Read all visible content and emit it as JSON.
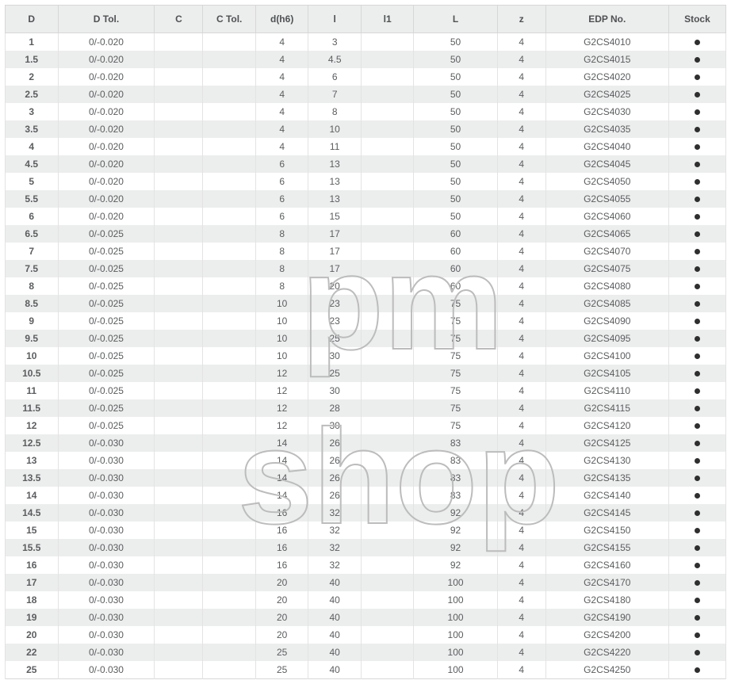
{
  "watermark": {
    "top": "pm",
    "bottom": "shop"
  },
  "columns": [
    {
      "key": "D",
      "label": "D"
    },
    {
      "key": "Dtol",
      "label": "D Tol."
    },
    {
      "key": "C",
      "label": "C"
    },
    {
      "key": "Ctol",
      "label": "C Tol."
    },
    {
      "key": "dh6",
      "label": "d(h6)"
    },
    {
      "key": "l",
      "label": "l"
    },
    {
      "key": "l1",
      "label": "l1"
    },
    {
      "key": "L",
      "label": "L"
    },
    {
      "key": "z",
      "label": "z"
    },
    {
      "key": "edp",
      "label": "EDP No."
    },
    {
      "key": "stock",
      "label": "Stock"
    }
  ],
  "rows": [
    {
      "D": "1",
      "Dtol": "0/-0.020",
      "C": "",
      "Ctol": "",
      "dh6": "4",
      "l": "3",
      "l1": "",
      "L": "50",
      "z": "4",
      "edp": "G2CS4010",
      "stock": "●"
    },
    {
      "D": "1.5",
      "Dtol": "0/-0.020",
      "C": "",
      "Ctol": "",
      "dh6": "4",
      "l": "4.5",
      "l1": "",
      "L": "50",
      "z": "4",
      "edp": "G2CS4015",
      "stock": "●"
    },
    {
      "D": "2",
      "Dtol": "0/-0.020",
      "C": "",
      "Ctol": "",
      "dh6": "4",
      "l": "6",
      "l1": "",
      "L": "50",
      "z": "4",
      "edp": "G2CS4020",
      "stock": "●"
    },
    {
      "D": "2.5",
      "Dtol": "0/-0.020",
      "C": "",
      "Ctol": "",
      "dh6": "4",
      "l": "7",
      "l1": "",
      "L": "50",
      "z": "4",
      "edp": "G2CS4025",
      "stock": "●"
    },
    {
      "D": "3",
      "Dtol": "0/-0.020",
      "C": "",
      "Ctol": "",
      "dh6": "4",
      "l": "8",
      "l1": "",
      "L": "50",
      "z": "4",
      "edp": "G2CS4030",
      "stock": "●"
    },
    {
      "D": "3.5",
      "Dtol": "0/-0.020",
      "C": "",
      "Ctol": "",
      "dh6": "4",
      "l": "10",
      "l1": "",
      "L": "50",
      "z": "4",
      "edp": "G2CS4035",
      "stock": "●"
    },
    {
      "D": "4",
      "Dtol": "0/-0.020",
      "C": "",
      "Ctol": "",
      "dh6": "4",
      "l": "11",
      "l1": "",
      "L": "50",
      "z": "4",
      "edp": "G2CS4040",
      "stock": "●"
    },
    {
      "D": "4.5",
      "Dtol": "0/-0.020",
      "C": "",
      "Ctol": "",
      "dh6": "6",
      "l": "13",
      "l1": "",
      "L": "50",
      "z": "4",
      "edp": "G2CS4045",
      "stock": "●"
    },
    {
      "D": "5",
      "Dtol": "0/-0.020",
      "C": "",
      "Ctol": "",
      "dh6": "6",
      "l": "13",
      "l1": "",
      "L": "50",
      "z": "4",
      "edp": "G2CS4050",
      "stock": "●"
    },
    {
      "D": "5.5",
      "Dtol": "0/-0.020",
      "C": "",
      "Ctol": "",
      "dh6": "6",
      "l": "13",
      "l1": "",
      "L": "50",
      "z": "4",
      "edp": "G2CS4055",
      "stock": "●"
    },
    {
      "D": "6",
      "Dtol": "0/-0.020",
      "C": "",
      "Ctol": "",
      "dh6": "6",
      "l": "15",
      "l1": "",
      "L": "50",
      "z": "4",
      "edp": "G2CS4060",
      "stock": "●"
    },
    {
      "D": "6.5",
      "Dtol": "0/-0.025",
      "C": "",
      "Ctol": "",
      "dh6": "8",
      "l": "17",
      "l1": "",
      "L": "60",
      "z": "4",
      "edp": "G2CS4065",
      "stock": "●"
    },
    {
      "D": "7",
      "Dtol": "0/-0.025",
      "C": "",
      "Ctol": "",
      "dh6": "8",
      "l": "17",
      "l1": "",
      "L": "60",
      "z": "4",
      "edp": "G2CS4070",
      "stock": "●"
    },
    {
      "D": "7.5",
      "Dtol": "0/-0.025",
      "C": "",
      "Ctol": "",
      "dh6": "8",
      "l": "17",
      "l1": "",
      "L": "60",
      "z": "4",
      "edp": "G2CS4075",
      "stock": "●"
    },
    {
      "D": "8",
      "Dtol": "0/-0.025",
      "C": "",
      "Ctol": "",
      "dh6": "8",
      "l": "20",
      "l1": "",
      "L": "60",
      "z": "4",
      "edp": "G2CS4080",
      "stock": "●"
    },
    {
      "D": "8.5",
      "Dtol": "0/-0.025",
      "C": "",
      "Ctol": "",
      "dh6": "10",
      "l": "23",
      "l1": "",
      "L": "75",
      "z": "4",
      "edp": "G2CS4085",
      "stock": "●"
    },
    {
      "D": "9",
      "Dtol": "0/-0.025",
      "C": "",
      "Ctol": "",
      "dh6": "10",
      "l": "23",
      "l1": "",
      "L": "75",
      "z": "4",
      "edp": "G2CS4090",
      "stock": "●"
    },
    {
      "D": "9.5",
      "Dtol": "0/-0.025",
      "C": "",
      "Ctol": "",
      "dh6": "10",
      "l": "25",
      "l1": "",
      "L": "75",
      "z": "4",
      "edp": "G2CS4095",
      "stock": "●"
    },
    {
      "D": "10",
      "Dtol": "0/-0.025",
      "C": "",
      "Ctol": "",
      "dh6": "10",
      "l": "30",
      "l1": "",
      "L": "75",
      "z": "4",
      "edp": "G2CS4100",
      "stock": "●"
    },
    {
      "D": "10.5",
      "Dtol": "0/-0.025",
      "C": "",
      "Ctol": "",
      "dh6": "12",
      "l": "25",
      "l1": "",
      "L": "75",
      "z": "4",
      "edp": "G2CS4105",
      "stock": "●"
    },
    {
      "D": "11",
      "Dtol": "0/-0.025",
      "C": "",
      "Ctol": "",
      "dh6": "12",
      "l": "30",
      "l1": "",
      "L": "75",
      "z": "4",
      "edp": "G2CS4110",
      "stock": "●"
    },
    {
      "D": "11.5",
      "Dtol": "0/-0.025",
      "C": "",
      "Ctol": "",
      "dh6": "12",
      "l": "28",
      "l1": "",
      "L": "75",
      "z": "4",
      "edp": "G2CS4115",
      "stock": "●"
    },
    {
      "D": "12",
      "Dtol": "0/-0.025",
      "C": "",
      "Ctol": "",
      "dh6": "12",
      "l": "30",
      "l1": "",
      "L": "75",
      "z": "4",
      "edp": "G2CS4120",
      "stock": "●"
    },
    {
      "D": "12.5",
      "Dtol": "0/-0.030",
      "C": "",
      "Ctol": "",
      "dh6": "14",
      "l": "26",
      "l1": "",
      "L": "83",
      "z": "4",
      "edp": "G2CS4125",
      "stock": "●"
    },
    {
      "D": "13",
      "Dtol": "0/-0.030",
      "C": "",
      "Ctol": "",
      "dh6": "14",
      "l": "26",
      "l1": "",
      "L": "83",
      "z": "4",
      "edp": "G2CS4130",
      "stock": "●"
    },
    {
      "D": "13.5",
      "Dtol": "0/-0.030",
      "C": "",
      "Ctol": "",
      "dh6": "14",
      "l": "26",
      "l1": "",
      "L": "83",
      "z": "4",
      "edp": "G2CS4135",
      "stock": "●"
    },
    {
      "D": "14",
      "Dtol": "0/-0.030",
      "C": "",
      "Ctol": "",
      "dh6": "14",
      "l": "26",
      "l1": "",
      "L": "83",
      "z": "4",
      "edp": "G2CS4140",
      "stock": "●"
    },
    {
      "D": "14.5",
      "Dtol": "0/-0.030",
      "C": "",
      "Ctol": "",
      "dh6": "16",
      "l": "32",
      "l1": "",
      "L": "92",
      "z": "4",
      "edp": "G2CS4145",
      "stock": "●"
    },
    {
      "D": "15",
      "Dtol": "0/-0.030",
      "C": "",
      "Ctol": "",
      "dh6": "16",
      "l": "32",
      "l1": "",
      "L": "92",
      "z": "4",
      "edp": "G2CS4150",
      "stock": "●"
    },
    {
      "D": "15.5",
      "Dtol": "0/-0.030",
      "C": "",
      "Ctol": "",
      "dh6": "16",
      "l": "32",
      "l1": "",
      "L": "92",
      "z": "4",
      "edp": "G2CS4155",
      "stock": "●"
    },
    {
      "D": "16",
      "Dtol": "0/-0.030",
      "C": "",
      "Ctol": "",
      "dh6": "16",
      "l": "32",
      "l1": "",
      "L": "92",
      "z": "4",
      "edp": "G2CS4160",
      "stock": "●"
    },
    {
      "D": "17",
      "Dtol": "0/-0.030",
      "C": "",
      "Ctol": "",
      "dh6": "20",
      "l": "40",
      "l1": "",
      "L": "100",
      "z": "4",
      "edp": "G2CS4170",
      "stock": "●"
    },
    {
      "D": "18",
      "Dtol": "0/-0.030",
      "C": "",
      "Ctol": "",
      "dh6": "20",
      "l": "40",
      "l1": "",
      "L": "100",
      "z": "4",
      "edp": "G2CS4180",
      "stock": "●"
    },
    {
      "D": "19",
      "Dtol": "0/-0.030",
      "C": "",
      "Ctol": "",
      "dh6": "20",
      "l": "40",
      "l1": "",
      "L": "100",
      "z": "4",
      "edp": "G2CS4190",
      "stock": "●"
    },
    {
      "D": "20",
      "Dtol": "0/-0.030",
      "C": "",
      "Ctol": "",
      "dh6": "20",
      "l": "40",
      "l1": "",
      "L": "100",
      "z": "4",
      "edp": "G2CS4200",
      "stock": "●"
    },
    {
      "D": "22",
      "Dtol": "0/-0.030",
      "C": "",
      "Ctol": "",
      "dh6": "25",
      "l": "40",
      "l1": "",
      "L": "100",
      "z": "4",
      "edp": "G2CS4220",
      "stock": "●"
    },
    {
      "D": "25",
      "Dtol": "0/-0.030",
      "C": "",
      "Ctol": "",
      "dh6": "25",
      "l": "40",
      "l1": "",
      "L": "100",
      "z": "4",
      "edp": "G2CS4250",
      "stock": "●"
    }
  ]
}
